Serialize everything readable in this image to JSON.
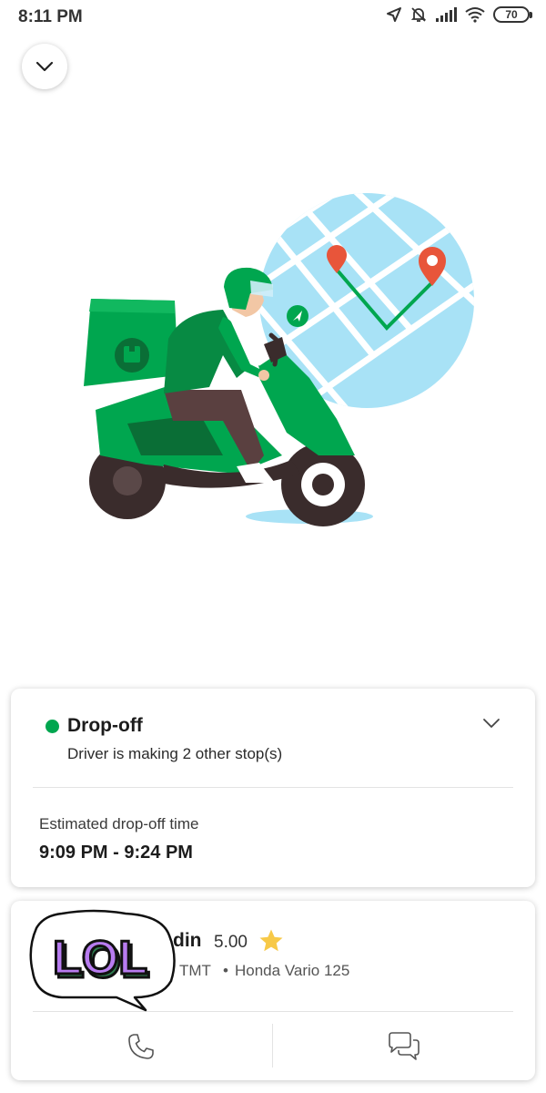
{
  "status_bar": {
    "time": "8:11 PM",
    "battery": "70",
    "icons": [
      "location-arrow-icon",
      "bell-muted-icon",
      "signal-icon",
      "wifi-icon",
      "battery-icon"
    ]
  },
  "header": {
    "collapse_icon": "chevron-down-icon"
  },
  "dropoff": {
    "title": "Drop-off",
    "subtitle": "Driver is making 2 other stop(s)",
    "eta_label": "Estimated drop-off time",
    "eta_value": "9:09 PM - 9:24 PM",
    "status_color": "#00a64f"
  },
  "driver": {
    "name_visible": "din",
    "rating": "5.00",
    "plate_visible": "TMT",
    "separator": "•",
    "vehicle": "Honda Vario 125",
    "actions": [
      "phone-icon",
      "chat-icon"
    ]
  },
  "sticker": {
    "text": "LOL"
  },
  "colors": {
    "brand_green": "#00a64f",
    "map_blue": "#a8e2f6",
    "pin_red": "#e8553a",
    "star_yellow": "#f7c948"
  }
}
